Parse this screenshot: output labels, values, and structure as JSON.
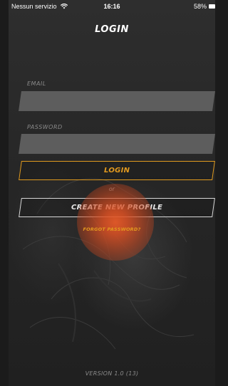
{
  "status_bar": {
    "carrier": "Nessun servizio",
    "time": "16:16",
    "battery": "58%"
  },
  "page": {
    "title": "LOGIN"
  },
  "form": {
    "email_label": "EMAIL",
    "email_value": "",
    "password_label": "PASSWORD",
    "password_value": ""
  },
  "actions": {
    "login_label": "LOGIN",
    "or_text": "or",
    "create_profile_label": "CREATE NEW PROFILE",
    "forgot_password_label": "FORGOT PASSWORD?"
  },
  "footer": {
    "version": "VERSION 1.0 (13)"
  },
  "colors": {
    "accent": "#e39a1f",
    "field_bg": "#5d5d5d",
    "background": "#262626"
  },
  "icons": [
    "wifi-icon",
    "battery-icon"
  ]
}
